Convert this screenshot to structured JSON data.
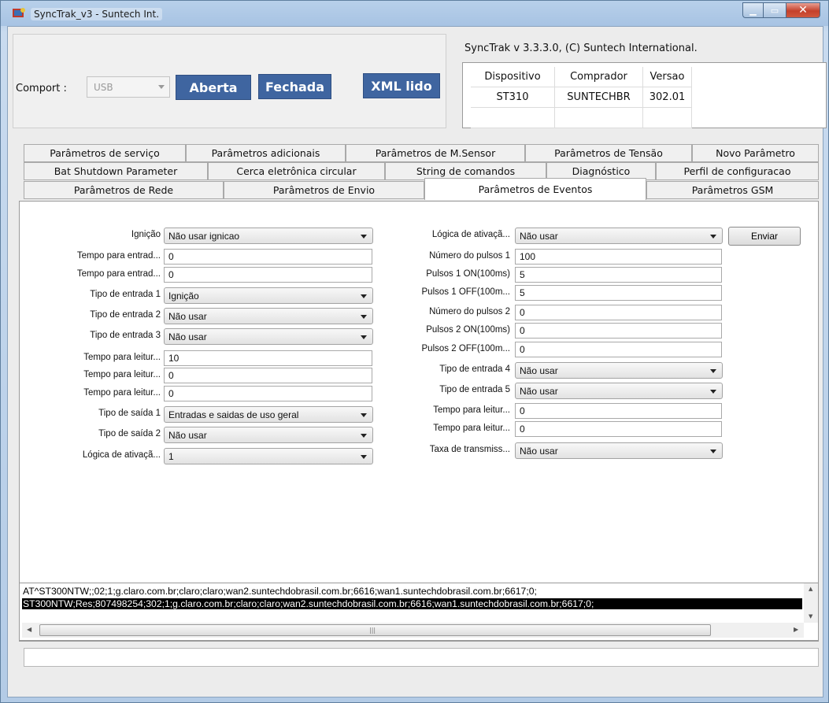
{
  "window": {
    "title": "SyncTrak_v3 - Suntech Int."
  },
  "comport": {
    "label": "Comport :",
    "value": "USB"
  },
  "buttons": {
    "aberta": "Aberta",
    "fechada": "Fechada",
    "xml": "XML lido",
    "enviar": "Enviar"
  },
  "version": "SyncTrak v 3.3.3.0, (C) Suntech International.",
  "device_table": {
    "headers": [
      "Dispositivo",
      "Comprador",
      "Versao"
    ],
    "row": [
      "ST310",
      "SUNTECHBR",
      "302.01"
    ]
  },
  "tabs": {
    "row1": [
      "Parâmetros de serviço",
      "Parâmetros adicionais",
      "Parâmetros  de M.Sensor",
      "Parâmetros de Tensão",
      "Novo Parâmetro"
    ],
    "row2": [
      "Bat Shutdown Parameter",
      "Cerca eletrônica circular",
      "String de comandos",
      "Diagnóstico",
      "Perfil de configuracao"
    ],
    "row3": [
      "Parâmetros de Rede",
      "Parâmetros de Envio",
      "Parâmetros de Eventos",
      "Parâmetros GSM"
    ],
    "active": "Parâmetros de Eventos"
  },
  "left_fields": [
    {
      "label": "Ignição",
      "kind": "select",
      "value": "Não usar ignicao"
    },
    {
      "label": "Tempo para entrad...",
      "kind": "text",
      "value": "0"
    },
    {
      "label": "Tempo para entrad...",
      "kind": "text",
      "value": "0"
    },
    {
      "label": "Tipo de entrada 1",
      "kind": "select",
      "value": "Ignição"
    },
    {
      "label": "Tipo de entrada 2",
      "kind": "select",
      "value": "Não usar"
    },
    {
      "label": "Tipo de entrada 3",
      "kind": "select",
      "value": "Não usar"
    },
    {
      "label": "Tempo para leitur...",
      "kind": "text",
      "value": "10"
    },
    {
      "label": "Tempo para leitur...",
      "kind": "text",
      "value": "0"
    },
    {
      "label": "Tempo para leitur...",
      "kind": "text",
      "value": "0"
    },
    {
      "label": "Tipo de saída 1",
      "kind": "select",
      "value": "Entradas e saidas de uso geral"
    },
    {
      "label": "Tipo de saída 2",
      "kind": "select",
      "value": "Não usar"
    },
    {
      "label": "Lógica de ativaçã...",
      "kind": "select",
      "value": "1"
    }
  ],
  "right_fields": [
    {
      "label": "Lógica de ativaçã...",
      "kind": "select",
      "value": "Não usar"
    },
    {
      "label": "Número do pulsos 1",
      "kind": "text",
      "value": "100"
    },
    {
      "label": "Pulsos 1 ON(100ms)",
      "kind": "text",
      "value": "5"
    },
    {
      "label": "Pulsos 1 OFF(100m...",
      "kind": "text",
      "value": "5"
    },
    {
      "label": "Número do pulsos 2",
      "kind": "text",
      "value": "0"
    },
    {
      "label": "Pulsos 2 ON(100ms)",
      "kind": "text",
      "value": "0"
    },
    {
      "label": "Pulsos 2 OFF(100m...",
      "kind": "text",
      "value": "0"
    },
    {
      "label": "Tipo de entrada 4",
      "kind": "select",
      "value": "Não usar"
    },
    {
      "label": "Tipo de entrada 5",
      "kind": "select",
      "value": "Não usar"
    },
    {
      "label": "Tempo para leitur...",
      "kind": "text",
      "value": "0"
    },
    {
      "label": "Tempo para leitur...",
      "kind": "text",
      "value": "0"
    },
    {
      "label": "Taxa de transmiss...",
      "kind": "select",
      "value": "Não usar"
    }
  ],
  "log": [
    "AT^ST300NTW;;02;1;g.claro.com.br;claro;claro;wan2.suntechdobrasil.com.br;6616;wan1.suntechdobrasil.com.br;6617;0;",
    "ST300NTW;Res;807498254;302;1;g.claro.com.br;claro;claro;wan2.suntechdobrasil.com.br;6616;wan1.suntechdobrasil.com.br;6617;0;"
  ],
  "status": ""
}
